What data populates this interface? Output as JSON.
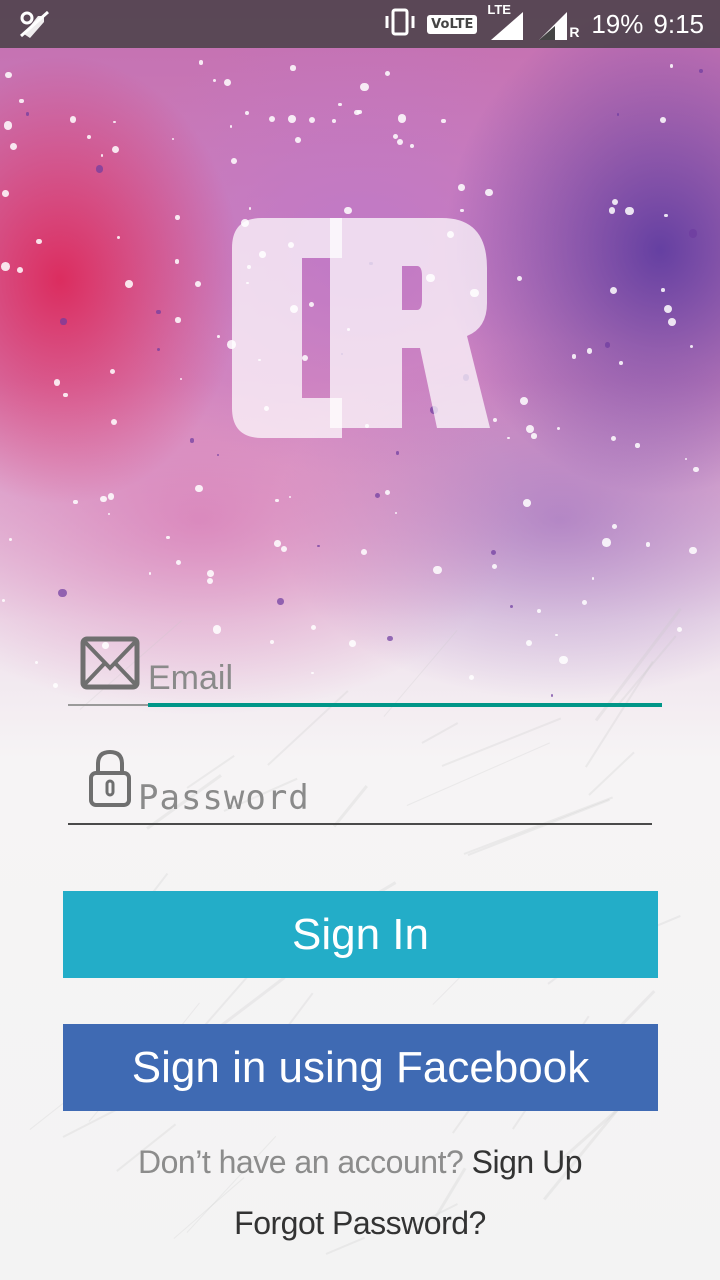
{
  "status_bar": {
    "battery": "19%",
    "time": "9:15",
    "volte": "VoLTE",
    "lte": "LTE",
    "roaming": "R"
  },
  "logo": {
    "text": "CR"
  },
  "form": {
    "email": {
      "placeholder": "Email",
      "value": ""
    },
    "password": {
      "placeholder": "Password",
      "value": ""
    }
  },
  "buttons": {
    "sign_in": "Sign In",
    "facebook": "Sign in using Facebook"
  },
  "footer": {
    "no_account": "Don’t have an account?",
    "sign_up": "Sign Up",
    "forgot": "Forgot Password?"
  },
  "colors": {
    "accent_teal": "#009688",
    "sign_in_bg": "#23adc8",
    "facebook_bg": "#3f6ab3",
    "status_bar": "#4a4a4a"
  },
  "icons": {
    "status_left": "no-signal-sync-icon",
    "email": "envelope-icon",
    "password": "lock-icon"
  }
}
